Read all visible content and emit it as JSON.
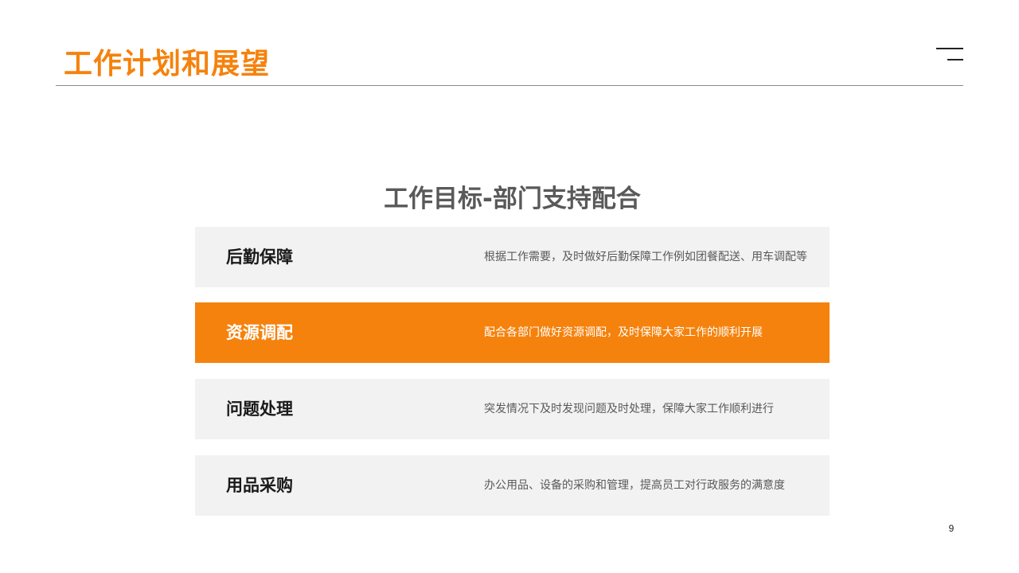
{
  "header": {
    "title": "工作计划和展望"
  },
  "section": {
    "heading": "工作目标-部门支持配合"
  },
  "items": [
    {
      "label": "后勤保障",
      "description": "根据工作需要，及时做好后勤保障工作例如团餐配送、用车调配等",
      "highlighted": false
    },
    {
      "label": "资源调配",
      "description": "配合各部门做好资源调配，及时保障大家工作的顺利开展",
      "highlighted": true
    },
    {
      "label": "问题处理",
      "description": "突发情况下及时发现问题及时处理，保障大家工作顺利进行",
      "highlighted": false
    },
    {
      "label": "用品采购",
      "description": "办公用品、设备的采购和管理，提高员工对行政服务的满意度",
      "highlighted": false
    }
  ],
  "footer": {
    "page_number": "9"
  },
  "colors": {
    "accent": "#f5820d",
    "row_background": "#f2f2f2",
    "heading_text": "#595959",
    "label_text": "#1a1a1a"
  }
}
